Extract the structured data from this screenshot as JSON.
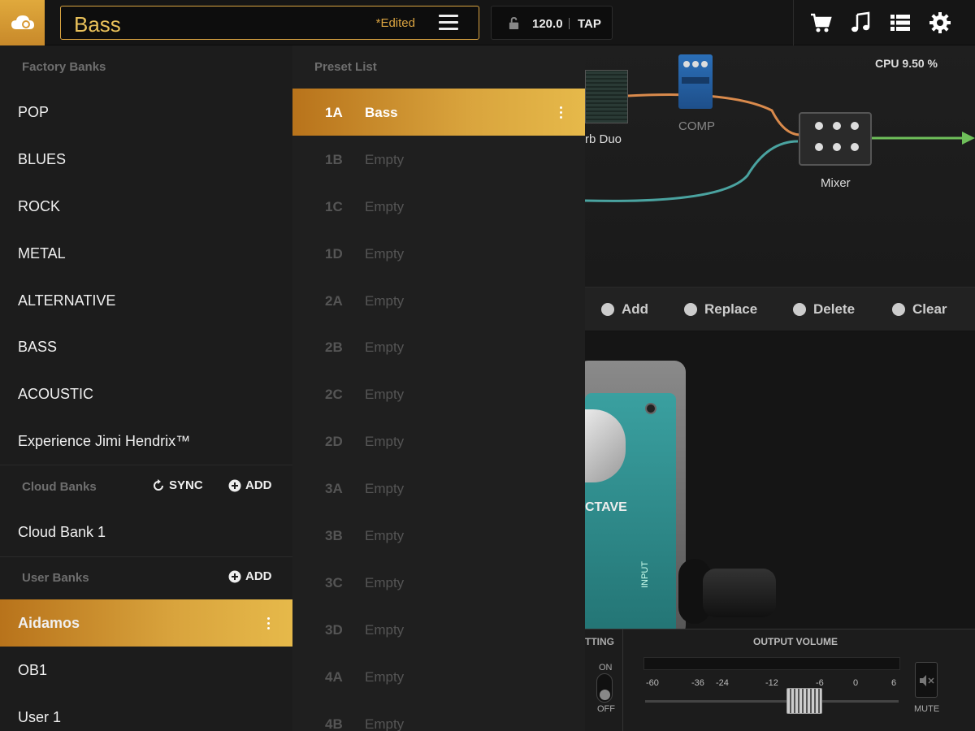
{
  "header": {
    "preset_name": "Bass",
    "edited_label": "*Edited",
    "tempo": "120.0",
    "tap_label": "TAP",
    "icons": [
      "cloud-icon",
      "menu-icon",
      "lock-icon",
      "cart-icon",
      "music-note-icon",
      "list-icon",
      "gear-icon"
    ]
  },
  "chain": {
    "cpu": "CPU 9.50 %",
    "nodes": {
      "reverb": "rb Duo",
      "comp": "COMP",
      "mixer": "Mixer"
    }
  },
  "actions": {
    "add": "Add",
    "replace": "Replace",
    "delete": "Delete",
    "clear": "Clear"
  },
  "pedal": {
    "name_fragment": "CTAVE",
    "input_label": "INPUT"
  },
  "bottom": {
    "setting_label": "TTING",
    "output_volume_label": "OUTPUT VOLUME",
    "on_label": "ON",
    "off_label": "OFF",
    "mute_label": "MUTE",
    "ticks": [
      "-60",
      "-36",
      "-24",
      "-12",
      "-6",
      "0",
      "6"
    ]
  },
  "banks": {
    "factory_header": "Factory Banks",
    "factory": [
      "POP",
      "BLUES",
      "ROCK",
      "METAL",
      "ALTERNATIVE",
      "BASS",
      "ACOUSTIC",
      "Experience Jimi Hendrix™"
    ],
    "cloud_header": "Cloud Banks",
    "sync_label": "SYNC",
    "add_label": "ADD",
    "cloud": [
      "Cloud Bank 1"
    ],
    "user_header": "User Banks",
    "user": [
      "Aidamos",
      "OB1",
      "User 1"
    ],
    "selected_user": "Aidamos"
  },
  "presets": {
    "header": "Preset List",
    "rows": [
      {
        "slot": "1A",
        "name": "Bass"
      },
      {
        "slot": "1B",
        "name": "Empty"
      },
      {
        "slot": "1C",
        "name": "Empty"
      },
      {
        "slot": "1D",
        "name": "Empty"
      },
      {
        "slot": "2A",
        "name": "Empty"
      },
      {
        "slot": "2B",
        "name": "Empty"
      },
      {
        "slot": "2C",
        "name": "Empty"
      },
      {
        "slot": "2D",
        "name": "Empty"
      },
      {
        "slot": "3A",
        "name": "Empty"
      },
      {
        "slot": "3B",
        "name": "Empty"
      },
      {
        "slot": "3C",
        "name": "Empty"
      },
      {
        "slot": "3D",
        "name": "Empty"
      },
      {
        "slot": "4A",
        "name": "Empty"
      },
      {
        "slot": "4B",
        "name": "Empty"
      }
    ],
    "selected_slot": "1A"
  },
  "colors": {
    "accent": "#d9a341",
    "selection_start": "#b8731b",
    "selection_end": "#e6b94a",
    "cable_orange": "#d98a4c",
    "cable_teal": "#4aa3a0",
    "cable_green": "#6fbf5a",
    "pedal_teal": "#2f8f8f"
  }
}
